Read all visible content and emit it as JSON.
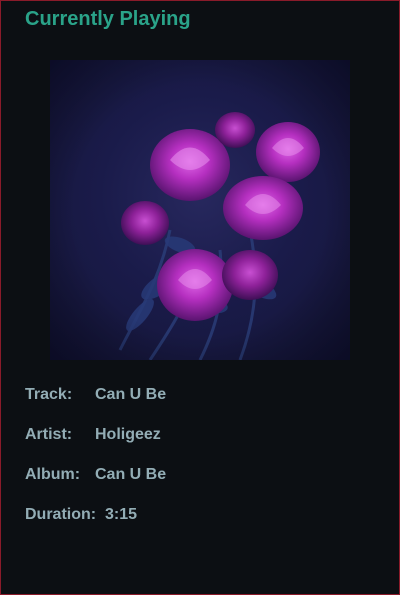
{
  "header": {
    "title": "Currently Playing"
  },
  "album_art": {
    "description_icon": "rose-bouquet-artwork"
  },
  "track_info": {
    "track_label": "Track:",
    "track_value": "Can U Be",
    "artist_label": "Artist:",
    "artist_value": "Holigeez",
    "album_label": "Album:",
    "album_value": "Can U Be",
    "duration_label": "Duration:",
    "duration_value": "3:15"
  },
  "colors": {
    "background": "#0c0f13",
    "accent": "#2aa389",
    "text": "#93adb5",
    "border": "#8a1b2a"
  }
}
